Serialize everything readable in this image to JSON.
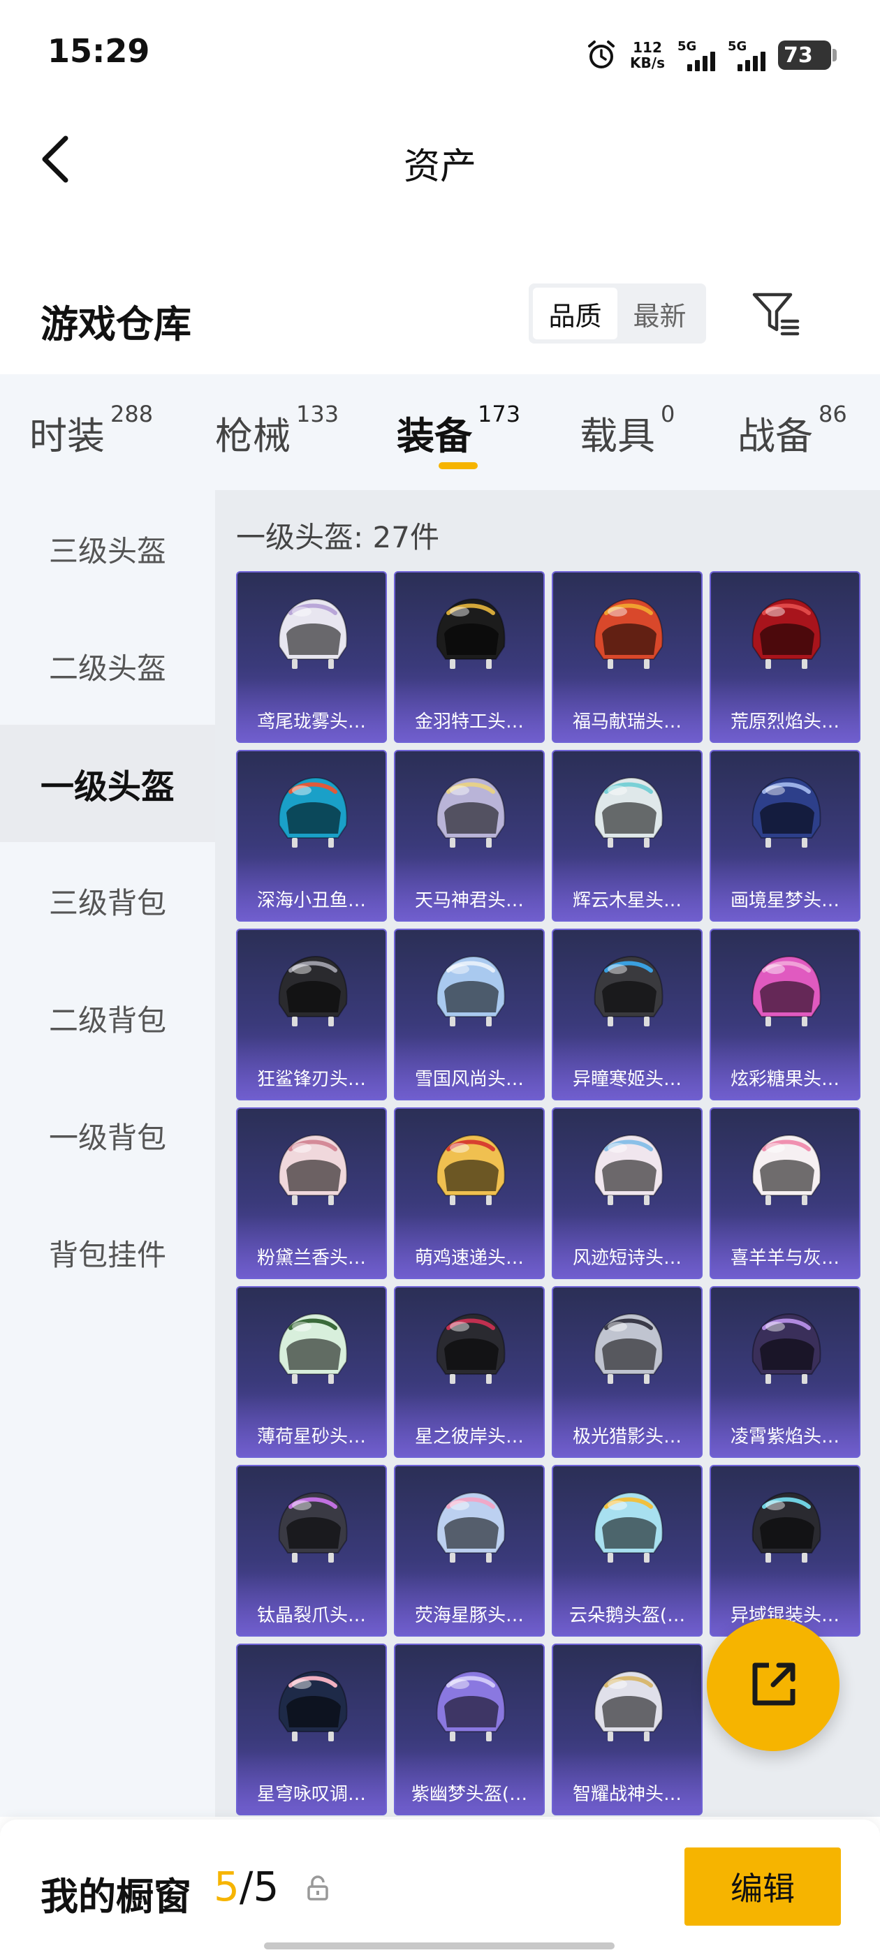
{
  "status": {
    "time": "15:29",
    "net_speed_value": "112",
    "net_speed_unit": "KB/s",
    "sim1_label": "5G",
    "sim2_label": "5G",
    "battery": "73"
  },
  "nav": {
    "title": "资产",
    "back_icon": "chevron-left-icon"
  },
  "section": {
    "title": "游戏仓库",
    "sort_options": [
      "品质",
      "最新"
    ],
    "sort_active": "品质",
    "filter_icon": "filter-icon"
  },
  "tabs": [
    {
      "label": "时装",
      "count": "288"
    },
    {
      "label": "枪械",
      "count": "133"
    },
    {
      "label": "装备",
      "count": "173",
      "active": true
    },
    {
      "label": "载具",
      "count": "0"
    },
    {
      "label": "战备",
      "count": "86"
    }
  ],
  "sidebar": [
    {
      "label": "三级头盔"
    },
    {
      "label": "二级头盔"
    },
    {
      "label": "一级头盔",
      "active": true
    },
    {
      "label": "三级背包"
    },
    {
      "label": "二级背包"
    },
    {
      "label": "一级背包"
    },
    {
      "label": "背包挂件"
    }
  ],
  "grid": {
    "count_label": "一级头盔: 27件",
    "items": [
      {
        "name": "鸢尾珑雾头…",
        "color": "#e8e6f0",
        "accent": "#b9a6d8"
      },
      {
        "name": "金羽特工头…",
        "color": "#1c1c1c",
        "accent": "#d4a83a"
      },
      {
        "name": "福马献瑞头…",
        "color": "#d9482b",
        "accent": "#f0a030"
      },
      {
        "name": "荒原烈焰头…",
        "color": "#a8141c",
        "accent": "#e04848"
      },
      {
        "name": "深海小丑鱼…",
        "color": "#1aa0c8",
        "accent": "#e05a3a"
      },
      {
        "name": "天马神君头…",
        "color": "#b9b4d8",
        "accent": "#e6d08a"
      },
      {
        "name": "辉云木星头…",
        "color": "#dfe8ea",
        "accent": "#79d0d6"
      },
      {
        "name": "画境星梦头…",
        "color": "#2d3f8a",
        "accent": "#9bb0e6"
      },
      {
        "name": "狂鲨锋刃头…",
        "color": "#2a2a2e",
        "accent": "#9a9aa4"
      },
      {
        "name": "雪国风尚头…",
        "color": "#a9c9ef",
        "accent": "#e4eefa"
      },
      {
        "name": "异瞳寒姬头…",
        "color": "#3a3a3e",
        "accent": "#3aa0e0"
      },
      {
        "name": "炫彩糖果头…",
        "color": "#e05ac0",
        "accent": "#f0a0d8"
      },
      {
        "name": "粉黛兰香头…",
        "color": "#f0d8dc",
        "accent": "#d48a98"
      },
      {
        "name": "萌鸡速递头…",
        "color": "#f0c050",
        "accent": "#d84030"
      },
      {
        "name": "风迹短诗头…",
        "color": "#f0e6ee",
        "accent": "#8ac0e8"
      },
      {
        "name": "喜羊羊与灰…",
        "color": "#f6f0f2",
        "accent": "#f090b0"
      },
      {
        "name": "薄荷星砂头…",
        "color": "#d8efdc",
        "accent": "#3a6a3a"
      },
      {
        "name": "星之彼岸头…",
        "color": "#2a2a30",
        "accent": "#c03050"
      },
      {
        "name": "极光猎影头…",
        "color": "#c0c4d0",
        "accent": "#3a3a48"
      },
      {
        "name": "凌霄紫焰头…",
        "color": "#3a2f5a",
        "accent": "#b08ae0"
      },
      {
        "name": "钛晶裂爪头…",
        "color": "#3a3a44",
        "accent": "#c070e0"
      },
      {
        "name": "荧海星豚头…",
        "color": "#bcd0f0",
        "accent": "#f0a8c8"
      },
      {
        "name": "云朵鹅头盔(…",
        "color": "#a8e0f0",
        "accent": "#f0c040"
      },
      {
        "name": "异域锟装头…",
        "color": "#2a2a30",
        "accent": "#70d0e0"
      },
      {
        "name": "星穹咏叹调…",
        "color": "#1e2a48",
        "accent": "#f0b0c0"
      },
      {
        "name": "紫幽梦头盔(…",
        "color": "#8a78e0",
        "accent": "#d0c8f8"
      },
      {
        "name": "智耀战神头…",
        "color": "#e0e0ea",
        "accent": "#d8b870"
      }
    ]
  },
  "share_icon": "share-icon",
  "bottom": {
    "label": "我的橱窗",
    "current": "5",
    "separator": "/",
    "total": "5",
    "lock_icon": "lock-icon",
    "edit_label": "编辑"
  }
}
